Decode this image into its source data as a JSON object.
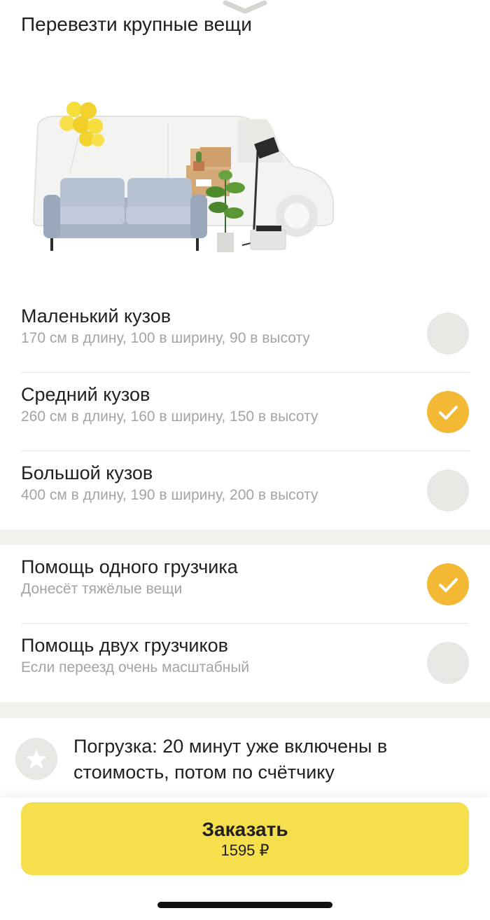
{
  "header": {
    "title": "Перевезти крупные вещи"
  },
  "body_sizes": [
    {
      "name": "Маленький кузов",
      "description": "170 см в длину, 100 в ширину, 90 в высоту",
      "selected": false
    },
    {
      "name": "Средний кузов",
      "description": "260 см в длину, 160 в ширину, 150 в высоту",
      "selected": true
    },
    {
      "name": "Большой кузов",
      "description": "400 см в длину, 190 в ширину, 200 в высоту",
      "selected": false
    }
  ],
  "movers": [
    {
      "name": "Помощь одного грузчика",
      "description": "Донесёт тяжёлые вещи",
      "selected": true
    },
    {
      "name": "Помощь двух грузчиков",
      "description": "Если переезд очень масштабный",
      "selected": false
    }
  ],
  "info": {
    "text": "Погрузка: 20 минут уже включены в стоимость, потом по счётчику",
    "icon": "star-icon"
  },
  "order": {
    "label": "Заказать",
    "price": "1595 ₽"
  },
  "colors": {
    "accent_yellow": "#f5df4d",
    "check_orange": "#f3b935",
    "radio_off": "#e8e7e4",
    "secondary_text": "#a5a4a2",
    "section_gap": "#f1f0ed"
  }
}
